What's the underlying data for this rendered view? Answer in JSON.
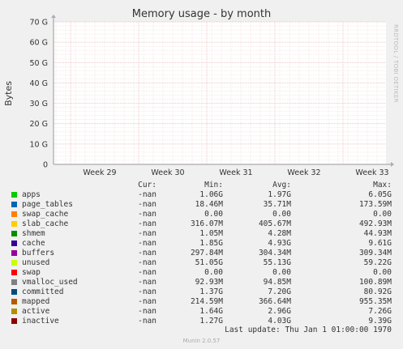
{
  "chart_data": {
    "type": "area",
    "title": "Memory usage - by month",
    "ylabel": "Bytes",
    "side_label": "RRDTOOL / TOBI OETIKER",
    "yticks": [
      "0",
      "10 G",
      "20 G",
      "30 G",
      "40 G",
      "50 G",
      "60 G",
      "70 G"
    ],
    "ylim": [
      0,
      70
    ],
    "xticks": [
      "Week 29",
      "Week 30",
      "Week 31",
      "Week 32",
      "Week 33"
    ],
    "grid": true,
    "series": []
  },
  "legend": {
    "headers": {
      "cur": "Cur:",
      "min": "Min:",
      "avg": "Avg:",
      "max": "Max:"
    },
    "rows": [
      {
        "name": "apps",
        "color": "#00cc00",
        "cur": "-nan",
        "min": "1.06G",
        "avg": "1.97G",
        "max": "6.05G"
      },
      {
        "name": "page_tables",
        "color": "#0066b3",
        "cur": "-nan",
        "min": "18.46M",
        "avg": "35.71M",
        "max": "173.59M"
      },
      {
        "name": "swap_cache",
        "color": "#ff8000",
        "cur": "-nan",
        "min": "0.00",
        "avg": "0.00",
        "max": "0.00"
      },
      {
        "name": "slab_cache",
        "color": "#ffcc00",
        "cur": "-nan",
        "min": "316.07M",
        "avg": "405.67M",
        "max": "492.93M"
      },
      {
        "name": "shmem",
        "color": "#008f00",
        "cur": "-nan",
        "min": "1.05M",
        "avg": "4.28M",
        "max": "44.93M"
      },
      {
        "name": "cache",
        "color": "#330099",
        "cur": "-nan",
        "min": "1.85G",
        "avg": "4.93G",
        "max": "9.61G"
      },
      {
        "name": "buffers",
        "color": "#990099",
        "cur": "-nan",
        "min": "297.84M",
        "avg": "304.34M",
        "max": "309.34M"
      },
      {
        "name": "unused",
        "color": "#ccff00",
        "cur": "-nan",
        "min": "51.05G",
        "avg": "55.13G",
        "max": "59.22G"
      },
      {
        "name": "swap",
        "color": "#ff0000",
        "cur": "-nan",
        "min": "0.00",
        "avg": "0.00",
        "max": "0.00"
      },
      {
        "name": "vmalloc_used",
        "color": "#808080",
        "cur": "-nan",
        "min": "92.93M",
        "avg": "94.85M",
        "max": "100.89M"
      },
      {
        "name": "committed",
        "color": "#004d80",
        "cur": "-nan",
        "min": "1.37G",
        "avg": "7.20G",
        "max": "80.92G"
      },
      {
        "name": "mapped",
        "color": "#b35a00",
        "cur": "-nan",
        "min": "214.59M",
        "avg": "366.64M",
        "max": "955.35M"
      },
      {
        "name": "active",
        "color": "#b38f00",
        "cur": "-nan",
        "min": "1.64G",
        "avg": "2.96G",
        "max": "7.26G"
      },
      {
        "name": "inactive",
        "color": "#8f0000",
        "cur": "-nan",
        "min": "1.27G",
        "avg": "4.03G",
        "max": "9.39G"
      }
    ]
  },
  "last_update": "Last update: Thu Jan  1 01:00:00 1970",
  "footer": "Munin 2.0.57"
}
